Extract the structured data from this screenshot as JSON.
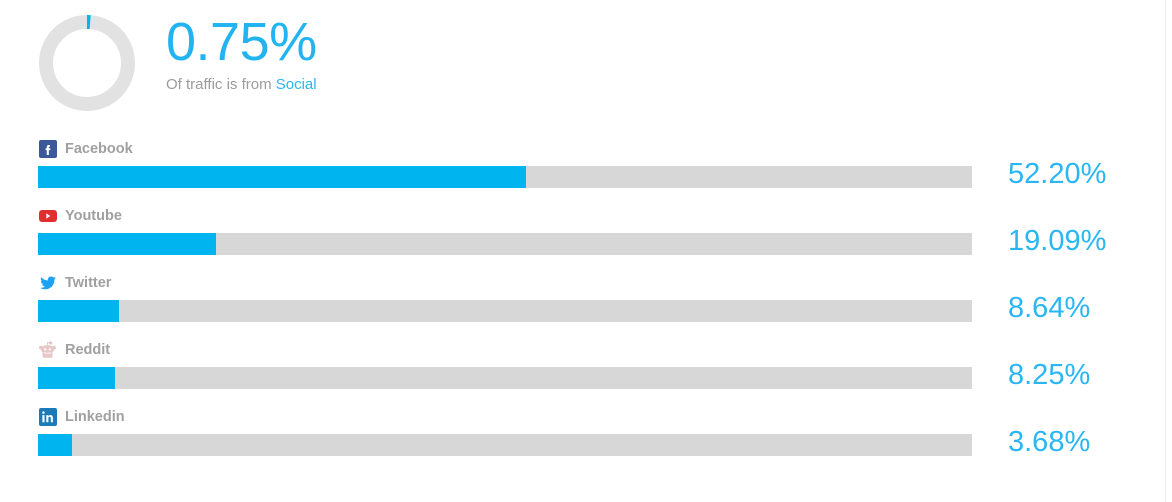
{
  "theme": {
    "accent": "#00b4f0",
    "accent_text": "#29b6f2",
    "track": "#d7d7d7",
    "label_gray": "#a0a0a0",
    "background": "#ffffff"
  },
  "summary": {
    "donut_icon": "donut-progress-icon",
    "percent": "0.75%",
    "percent_value": 0.75,
    "caption_prefix": "Of traffic is from",
    "caption_link": "Social"
  },
  "chart_data": {
    "type": "bar",
    "title": "Of traffic is from Social",
    "orientation": "horizontal",
    "xlabel": "",
    "ylabel": "",
    "xlim": [
      0,
      100
    ],
    "grid": false,
    "legend": "none",
    "value_suffix": "%",
    "categories": [
      "Facebook",
      "Youtube",
      "Twitter",
      "Reddit",
      "Linkedin"
    ],
    "values": [
      52.2,
      19.09,
      8.64,
      8.25,
      3.68
    ],
    "labels": [
      "52.20%",
      "19.09%",
      "8.64%",
      "8.25%",
      "3.68%"
    ],
    "total_percent": "0.75%"
  },
  "rows": [
    {
      "name": "Facebook",
      "icon": "facebook-icon",
      "icon_color": "#3b5998",
      "value": 52.2,
      "value_label": "52.20%"
    },
    {
      "name": "Youtube",
      "icon": "youtube-icon",
      "icon_color": "#e02f2f",
      "value": 19.09,
      "value_label": "19.09%"
    },
    {
      "name": "Twitter",
      "icon": "twitter-icon",
      "icon_color": "#1da1f2",
      "value": 8.64,
      "value_label": "8.64%"
    },
    {
      "name": "Reddit",
      "icon": "reddit-icon",
      "icon_color": "#d9b0b0",
      "value": 8.25,
      "value_label": "8.25%"
    },
    {
      "name": "Linkedin",
      "icon": "linkedin-icon",
      "icon_color": "#1b7bb9",
      "value": 3.68,
      "value_label": "3.68%"
    }
  ]
}
